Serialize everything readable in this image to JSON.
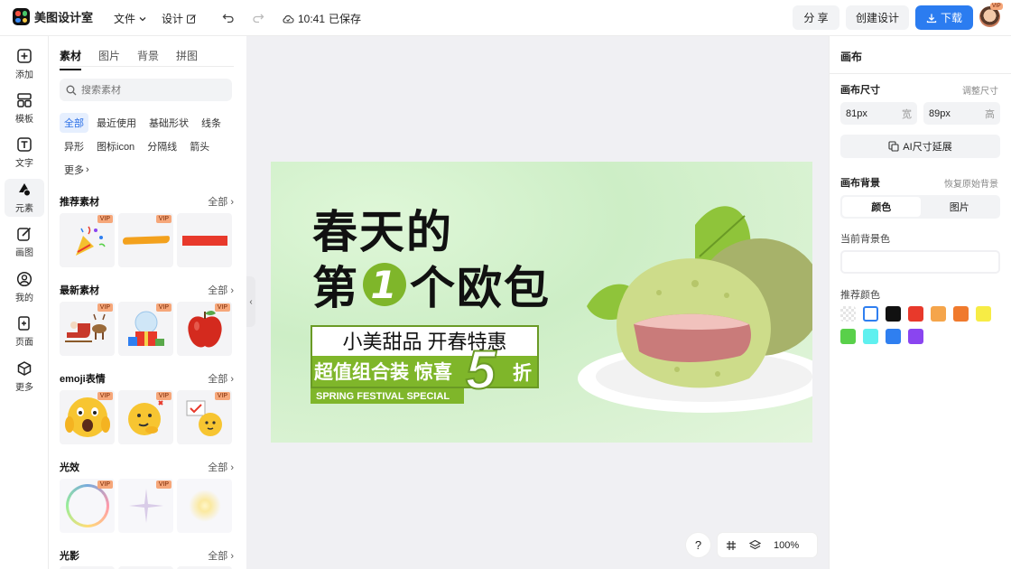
{
  "app": {
    "name": "美图设计室",
    "save_time": "10:41",
    "save_status": "已保存"
  },
  "header": {
    "file_menu": "文件",
    "design_menu": "设计",
    "share_label": "分 享",
    "create_label": "创建设计",
    "download_label": "下载",
    "avatar_badge": "VIP",
    "accent": "#2b7cf0"
  },
  "rail": [
    {
      "label": "添加",
      "icon": "plus-square-icon"
    },
    {
      "label": "模板",
      "icon": "template-grid-icon"
    },
    {
      "label": "文字",
      "icon": "text-icon"
    },
    {
      "label": "元素",
      "icon": "shapes-icon"
    },
    {
      "label": "画图",
      "icon": "edit-pen-icon"
    },
    {
      "label": "我的",
      "icon": "user-icon"
    },
    {
      "label": "页面",
      "icon": "add-page-icon"
    },
    {
      "label": "更多",
      "icon": "cube-icon"
    }
  ],
  "panel": {
    "tabs": [
      "素材",
      "图片",
      "背景",
      "拼图"
    ],
    "search_placeholder": "搜索素材",
    "chips": [
      "全部",
      "最近使用",
      "基础形状",
      "线条",
      "异形",
      "图标icon",
      "分隔线",
      "箭头",
      "更多"
    ],
    "vip_label": "VIP",
    "see_all": "全部",
    "sections": [
      {
        "title": "推荐素材"
      },
      {
        "title": "最新素材"
      },
      {
        "title": "emoji表情"
      },
      {
        "title": "光效"
      },
      {
        "title": "光影"
      }
    ]
  },
  "artboard": {
    "line1": "春天的",
    "line2_a": "第",
    "line2_num": "1",
    "line2_b": "个欧包",
    "banner_top": "小美甜品 开春特惠",
    "banner_mid": "超值组合装 惊喜",
    "banner_num": "5",
    "banner_zhe": "折",
    "banner_en": "SPRING FESTIVAL SPECIAL"
  },
  "right_panel": {
    "title": "画布",
    "size_label": "画布尺寸",
    "resize_link": "调整尺寸",
    "width_value": "81px",
    "width_unit": "宽",
    "height_value": "89px",
    "height_unit": "高",
    "ai_button": "AI尺寸延展",
    "bg_label": "画布背景",
    "restore_link": "恢复原始背景",
    "seg_color": "颜色",
    "seg_image": "图片",
    "current_bg_label": "当前背景色",
    "recommend_label": "推荐颜色",
    "swatches": [
      "transparent",
      "#ffffff",
      "#111111",
      "#e8392b",
      "#f5a54b",
      "#f07a2d",
      "#f7ec45",
      "#59d04a",
      "#5ff0ef",
      "#2f7ff0",
      "#8a45f0"
    ]
  },
  "bottom": {
    "help": "?",
    "zoom": "100%"
  }
}
